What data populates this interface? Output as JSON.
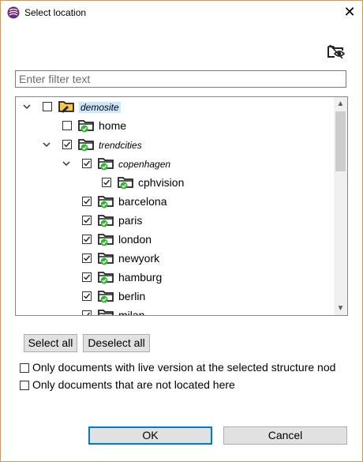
{
  "window": {
    "title": "Select location",
    "close_symbol": "✕"
  },
  "filter": {
    "placeholder": "Enter filter text",
    "value": ""
  },
  "tree": {
    "nodes": [
      {
        "label": "demosite",
        "level": 0,
        "expanded": true,
        "checked": false,
        "italic": true,
        "selected": true,
        "icon": "folder-pencil-icon"
      },
      {
        "label": "home",
        "level": 1,
        "expanded": null,
        "checked": false,
        "italic": false,
        "icon": "folder-check-icon"
      },
      {
        "label": "trendcities",
        "level": 1,
        "expanded": true,
        "checked": true,
        "italic": true,
        "icon": "folder-check-icon"
      },
      {
        "label": "copenhagen",
        "level": 2,
        "expanded": true,
        "checked": true,
        "italic": true,
        "icon": "folder-check-icon"
      },
      {
        "label": "cphvision",
        "level": 3,
        "expanded": null,
        "checked": true,
        "italic": false,
        "icon": "folder-check-icon"
      },
      {
        "label": "barcelona",
        "level": 2,
        "expanded": null,
        "checked": true,
        "italic": false,
        "icon": "folder-check-icon"
      },
      {
        "label": "paris",
        "level": 2,
        "expanded": null,
        "checked": true,
        "italic": false,
        "icon": "folder-check-icon"
      },
      {
        "label": "london",
        "level": 2,
        "expanded": null,
        "checked": true,
        "italic": false,
        "icon": "folder-check-icon"
      },
      {
        "label": "newyork",
        "level": 2,
        "expanded": null,
        "checked": true,
        "italic": false,
        "icon": "folder-check-icon"
      },
      {
        "label": "hamburg",
        "level": 2,
        "expanded": null,
        "checked": true,
        "italic": false,
        "icon": "folder-check-icon"
      },
      {
        "label": "berlin",
        "level": 2,
        "expanded": null,
        "checked": true,
        "italic": false,
        "icon": "folder-check-icon"
      },
      {
        "label": "milan",
        "level": 2,
        "expanded": null,
        "checked": true,
        "italic": false,
        "icon": "folder-check-icon"
      }
    ]
  },
  "buttons": {
    "select_all": "Select all",
    "deselect_all": "Deselect all",
    "ok": "OK",
    "cancel": "Cancel"
  },
  "options": {
    "live_version": {
      "label": "Only documents with live version at the selected structure nod",
      "checked": false
    },
    "not_located": {
      "label": "Only documents that are not located here",
      "checked": false
    }
  },
  "colors": {
    "accent_border": "#e8913a",
    "selection": "#cce8ff",
    "check_green": "#2db82d",
    "default_button": "#0078d7"
  }
}
